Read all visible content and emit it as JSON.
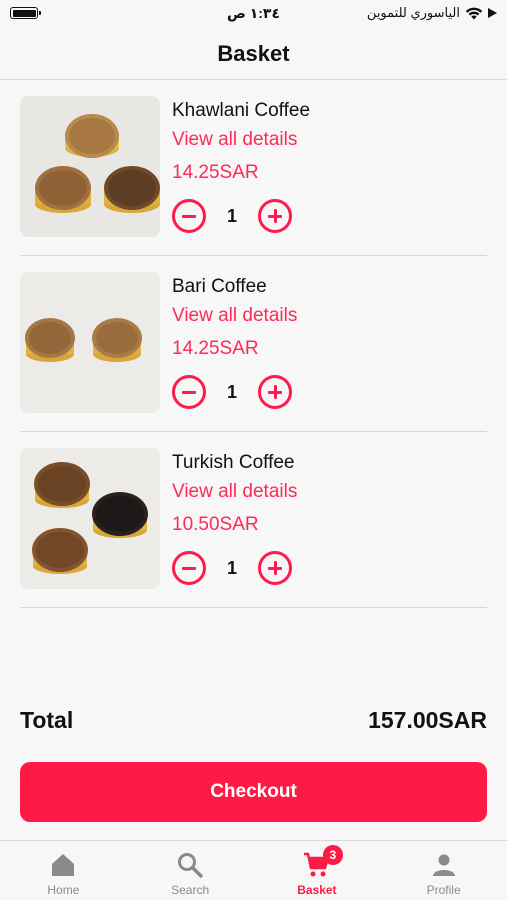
{
  "status_bar": {
    "time": "١:٣٤ ص",
    "carrier": "الياسوري للتموين"
  },
  "header": {
    "title": "Basket"
  },
  "items": [
    {
      "name": "Khawlani Coffee",
      "link": "View all details",
      "price": "14.25SAR",
      "quantity": "1"
    },
    {
      "name": "Bari Coffee",
      "link": "View all details",
      "price": "14.25SAR",
      "quantity": "1"
    },
    {
      "name": "Turkish Coffee",
      "link": "View all details",
      "price": "10.50SAR",
      "quantity": "1"
    }
  ],
  "total": {
    "label": "Total",
    "value": "157.00SAR"
  },
  "checkout": {
    "label": "Checkout"
  },
  "tabs": [
    {
      "label": "Home",
      "icon": "home-icon"
    },
    {
      "label": "Search",
      "icon": "search-icon"
    },
    {
      "label": "Basket",
      "icon": "cart-icon",
      "badge": "3",
      "active": true
    },
    {
      "label": "Profile",
      "icon": "profile-icon"
    }
  ],
  "colors": {
    "accent": "#ff1a46",
    "link": "#ff2a55",
    "inactive": "#8a8a8a"
  }
}
